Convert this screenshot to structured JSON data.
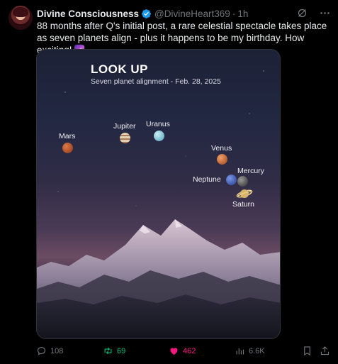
{
  "author": {
    "display_name": "Divine Consciousness",
    "handle": "@DivineHeart369",
    "separator": "·",
    "time": "1h",
    "verified": true
  },
  "tweet": {
    "text": "88 months after Q's initial post, a rare celestial spectacle takes place as seven planets align - plus it happens to be my birthday. How exciting!",
    "emoji": "milky-way-emoji"
  },
  "media": {
    "title": "LOOK UP",
    "subtitle": "Seven planet alignment - Feb. 28, 2025",
    "planets": [
      {
        "name": "Mars",
        "color": "#b5522b"
      },
      {
        "name": "Jupiter",
        "color": "#c9a27a"
      },
      {
        "name": "Uranus",
        "color": "#7fc6d6"
      },
      {
        "name": "Venus",
        "color": "#c9652e"
      },
      {
        "name": "Neptune",
        "color": "#3f5fc2"
      },
      {
        "name": "Mercury",
        "color": "#5a5a5a"
      },
      {
        "name": "Saturn",
        "color": "#d7b46a"
      }
    ]
  },
  "metrics": {
    "replies": "108",
    "reposts": "69",
    "likes": "462",
    "views": "6.6K"
  },
  "colors": {
    "background": "#000000",
    "text": "#e7e9ea",
    "muted": "#71767b",
    "verified": "#1d9bf0",
    "repost_active": "#00ba7c",
    "like_active": "#f91880"
  }
}
